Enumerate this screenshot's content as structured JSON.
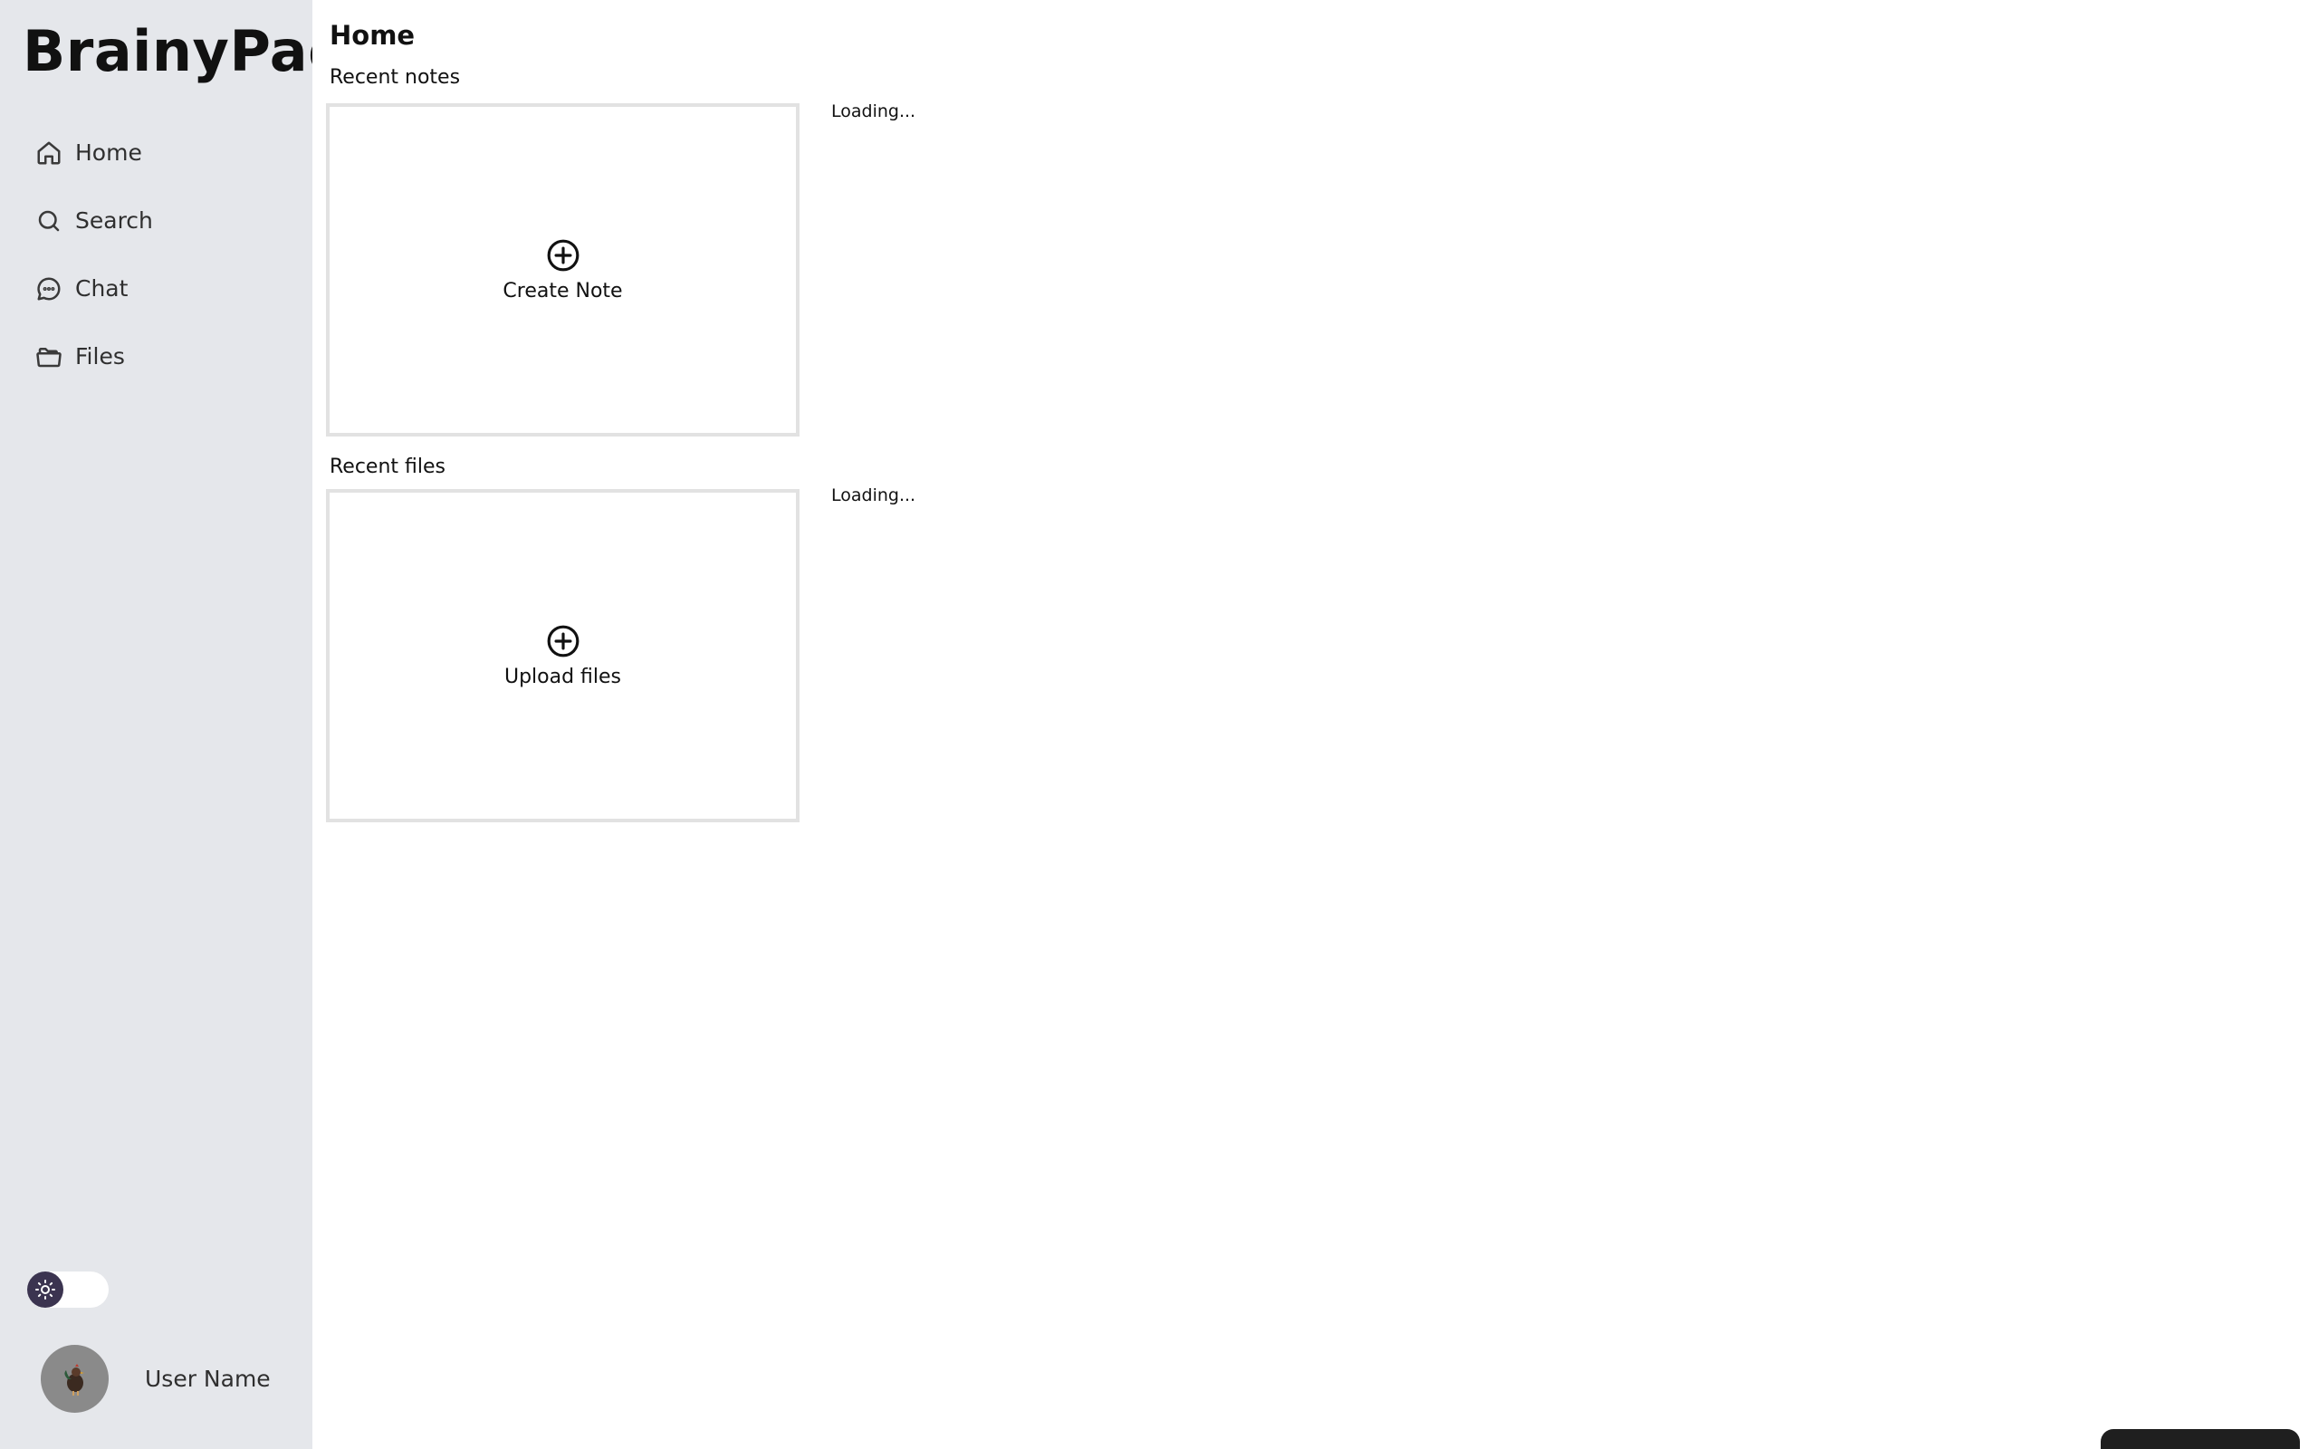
{
  "app": {
    "logo": "BrainyPad"
  },
  "sidebar": {
    "items": [
      {
        "label": "Home",
        "icon": "home-icon"
      },
      {
        "label": "Search",
        "icon": "search-icon"
      },
      {
        "label": "Chat",
        "icon": "chat-icon"
      },
      {
        "label": "Files",
        "icon": "folder-icon"
      }
    ],
    "theme_toggle": {
      "icon": "sun-icon",
      "mode": "light"
    },
    "user": {
      "name": "User Name",
      "avatar_icon": "avatar-icon"
    }
  },
  "main": {
    "title": "Home",
    "notes": {
      "section_title": "Recent notes",
      "card_label": "Create Note",
      "card_icon": "plus-circle-icon",
      "status": "Loading..."
    },
    "files": {
      "section_title": "Recent files",
      "card_label": "Upload files",
      "card_icon": "plus-circle-icon",
      "status": "Loading..."
    }
  },
  "colors": {
    "sidebar_bg": "#e5e7eb",
    "card_border": "#e2e2e2",
    "toggle_knob": "#3b3450"
  }
}
